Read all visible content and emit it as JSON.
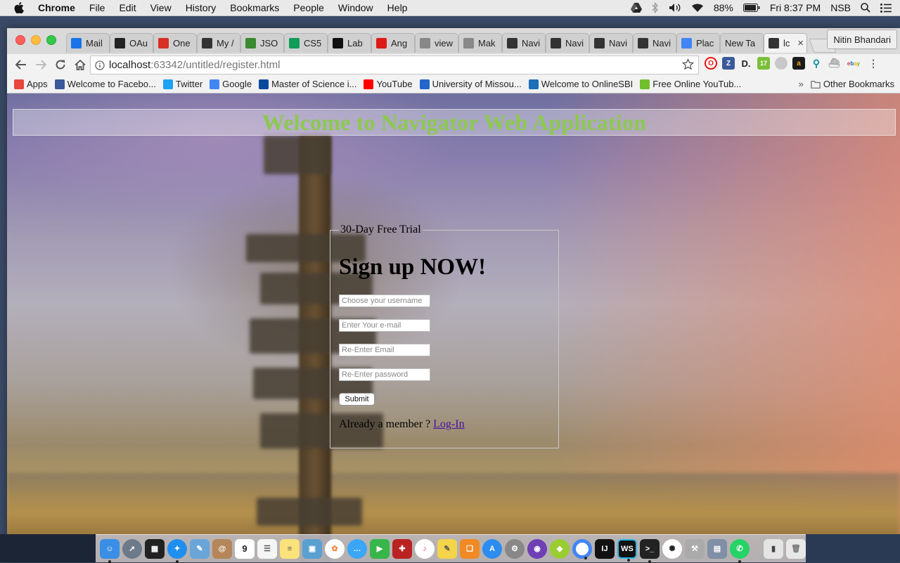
{
  "menubar": {
    "app_name": "Chrome",
    "items": [
      "File",
      "Edit",
      "View",
      "History",
      "Bookmarks",
      "People",
      "Window",
      "Help"
    ],
    "battery": "88%",
    "datetime": "Fri 8:37 PM",
    "user": "NSB"
  },
  "tabs": [
    {
      "label": "Mail",
      "icon": "mail-icon",
      "color": "#1a73e8"
    },
    {
      "label": "OAu",
      "icon": "oauth-icon",
      "color": "#222222"
    },
    {
      "label": "One",
      "icon": "gmail-icon",
      "color": "#d93025"
    },
    {
      "label": "My /",
      "icon": "webstorm-icon",
      "color": "#333333"
    },
    {
      "label": "JSO",
      "icon": "json-icon",
      "color": "#3a8a2f"
    },
    {
      "label": "CS5",
      "icon": "sheets-icon",
      "color": "#0f9d58"
    },
    {
      "label": "Lab",
      "icon": "github-icon",
      "color": "#111111"
    },
    {
      "label": "Ang",
      "icon": "angular-icon",
      "color": "#dd1b16"
    },
    {
      "label": "view",
      "icon": "page-icon",
      "color": "#888888"
    },
    {
      "label": "Mak",
      "icon": "page-icon",
      "color": "#888888"
    },
    {
      "label": "Navi",
      "icon": "webstorm-icon",
      "color": "#333333"
    },
    {
      "label": "Navi",
      "icon": "webstorm-icon",
      "color": "#333333"
    },
    {
      "label": "Navi",
      "icon": "webstorm-icon",
      "color": "#333333"
    },
    {
      "label": "Navi",
      "icon": "webstorm-icon",
      "color": "#333333"
    },
    {
      "label": "Plac",
      "icon": "chrome-icon",
      "color": "#4285f4"
    },
    {
      "label": "New Ta",
      "icon": "",
      "color": "#888888"
    },
    {
      "label": "lc",
      "icon": "webstorm-icon",
      "color": "#333333",
      "active": true
    }
  ],
  "profile_name": "Nitin Bhandari",
  "address": {
    "host": "localhost",
    "path": ":63342/untitled/register.html"
  },
  "bookmarks": [
    {
      "label": "Apps",
      "icon": "apps-grid-icon",
      "color": "#e8453c"
    },
    {
      "label": "Welcome to Facebo...",
      "icon": "facebook-icon",
      "color": "#3b5998"
    },
    {
      "label": "Twitter",
      "icon": "twitter-icon",
      "color": "#1da1f2"
    },
    {
      "label": "Google",
      "icon": "google-icon",
      "color": "#4285f4"
    },
    {
      "label": "Master of Science i...",
      "icon": "umkc-icon",
      "color": "#0a4a9c"
    },
    {
      "label": "YouTube",
      "icon": "youtube-icon",
      "color": "#ff0000"
    },
    {
      "label": "University of Missou...",
      "icon": "missouri-icon",
      "color": "#2266cc"
    },
    {
      "label": "Welcome to OnlineSBI",
      "icon": "sbi-icon",
      "color": "#1d6fb8"
    },
    {
      "label": "Free Online YouTub...",
      "icon": "download-icon",
      "color": "#6fbf2a"
    }
  ],
  "other_bookmarks": "Other Bookmarks",
  "page": {
    "banner_title": "Welcome to Navigator Web Application",
    "legend": "30-Day Free Trial",
    "heading": "Sign up NOW!",
    "username_placeholder": "Choose your username",
    "email_placeholder": "Enter Your e-mail",
    "reemail_placeholder": "Re-Enter Email",
    "password_placeholder": "Re-Enter password",
    "submit_label": "Submit",
    "member_text": "Already a member ? ",
    "login_link": "Log-In"
  },
  "dock": {
    "calendar_day": "9"
  }
}
